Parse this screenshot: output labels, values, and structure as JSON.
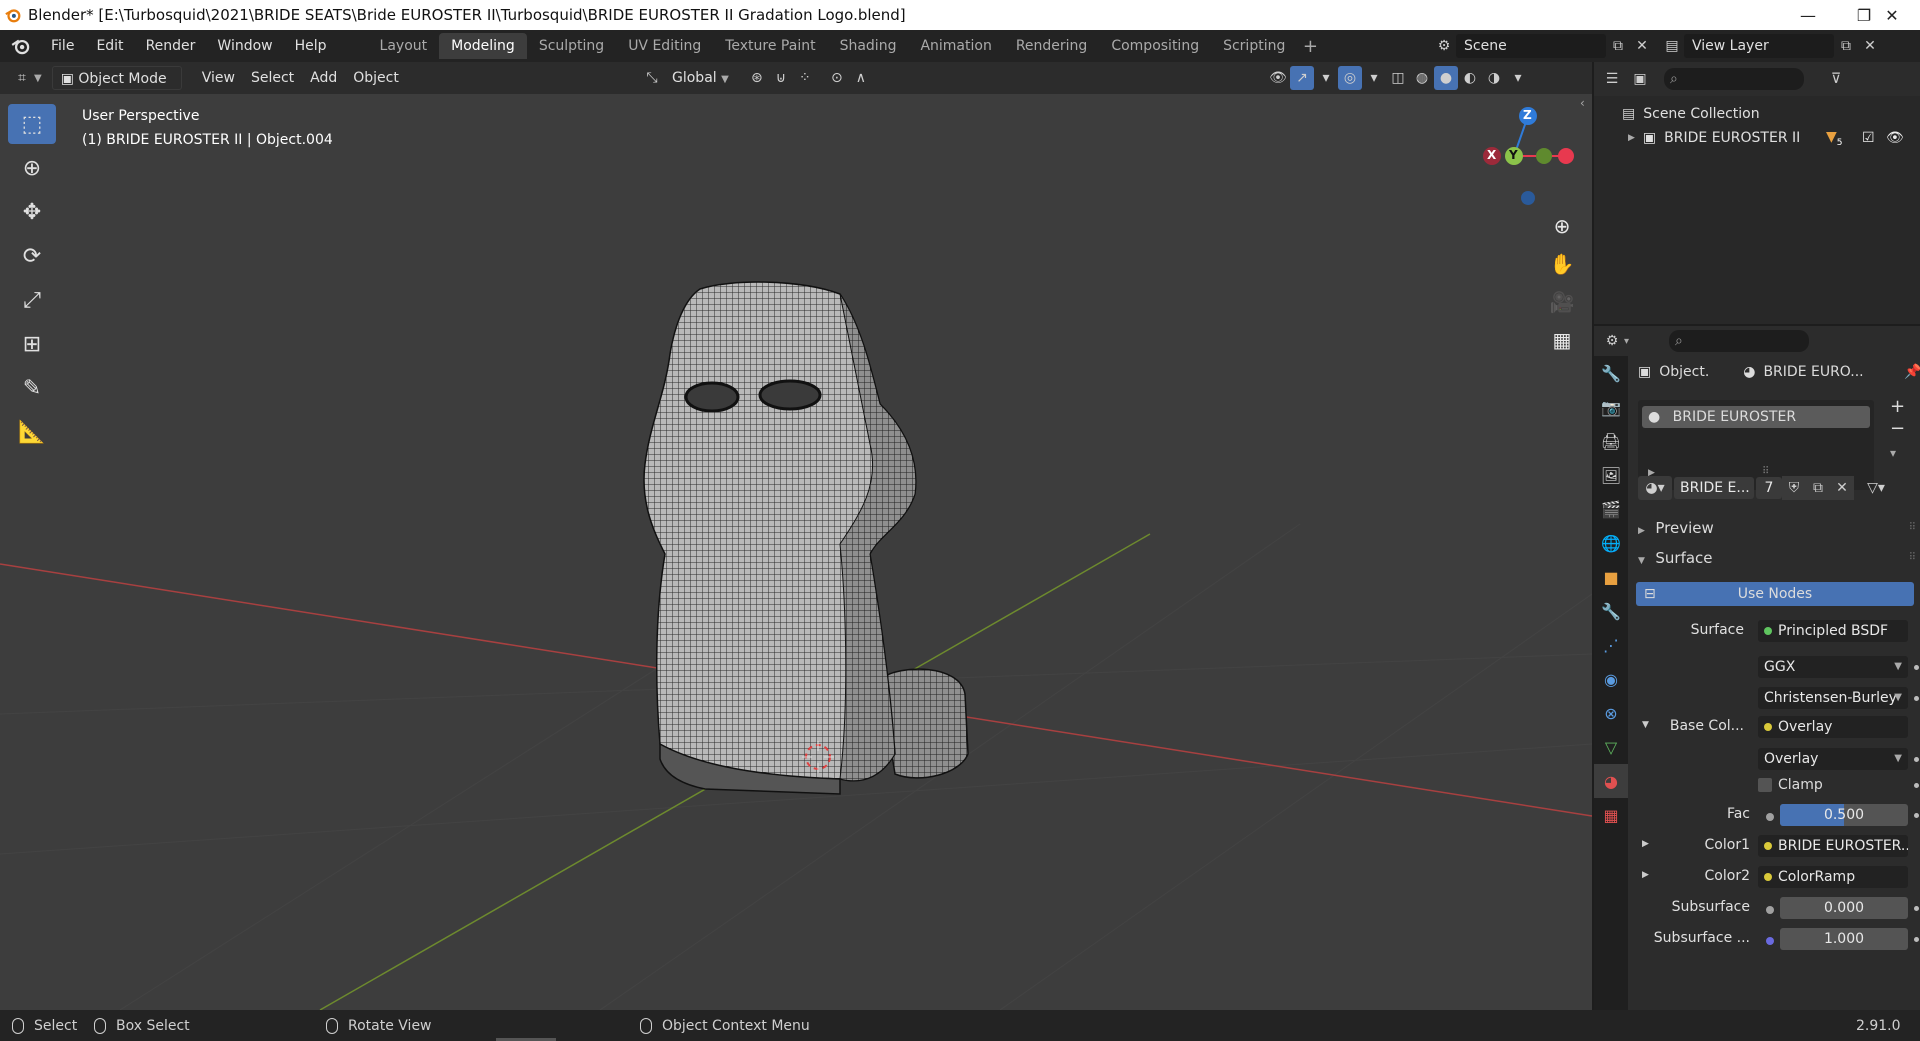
{
  "window": {
    "title": "Blender* [E:\\Turbosquid\\2021\\BRIDE SEATS\\Bride EUROSTER II\\Turbosquid\\BRIDE EUROSTER II Gradation Logo.blend]",
    "minimize_glyph": "—",
    "restore_glyph": "❐",
    "close_glyph": "✕"
  },
  "menu": [
    "File",
    "Edit",
    "Render",
    "Window",
    "Help"
  ],
  "workspaces": [
    "Layout",
    "Modeling",
    "Sculpting",
    "UV Editing",
    "Texture Paint",
    "Shading",
    "Animation",
    "Rendering",
    "Compositing",
    "Scripting"
  ],
  "active_workspace": "Modeling",
  "scene": {
    "name": "Scene"
  },
  "view_layer": {
    "name": "View Layer"
  },
  "viewport_header": {
    "mode": "Object Mode",
    "menus": [
      "View",
      "Select",
      "Add",
      "Object"
    ],
    "transform_orientation": "Global"
  },
  "viewport": {
    "perspective": "User Perspective",
    "object_info": "(1) BRIDE EUROSTER II | Object.004",
    "gizmo_axes": {
      "x": "X",
      "y": "Y",
      "z": "Z"
    }
  },
  "outliner": {
    "scene_collection": "Scene Collection",
    "items": [
      {
        "name": "BRIDE EUROSTER II",
        "badge": "5"
      }
    ]
  },
  "properties": {
    "context_object": "Object.",
    "context_material": "BRIDE EURO...",
    "material_slots": [
      "BRIDE EUROSTER"
    ],
    "material_name": "BRIDE E...",
    "user_count": "7",
    "panels": {
      "preview": "Preview",
      "surface": "Surface"
    },
    "use_nodes": "Use Nodes",
    "surface_label": "Surface",
    "surface_value": "Principled BSDF",
    "distribution": "GGX",
    "subsurface_method": "Christensen-Burley",
    "base_color_label": "Base Col...",
    "base_color_value": "Overlay",
    "blend_mode": "Overlay",
    "clamp_label": "Clamp",
    "fac_label": "Fac",
    "fac_value": "0.500",
    "fac": 0.5,
    "color1_label": "Color1",
    "color1_value": "BRIDE EUROSTER...",
    "color2_label": "Color2",
    "color2_value": "ColorRamp",
    "subsurface_label": "Subsurface",
    "subsurface_value": "0.000",
    "subsurface2_label": "Subsurface ...",
    "subsurface2_value": "1.000"
  },
  "statusbar": {
    "select": "Select",
    "box_select": "Box Select",
    "rotate_view": "Rotate View",
    "context_menu": "Object Context Menu",
    "version": "2.91.0"
  },
  "colors": {
    "accent": "#4772b3",
    "axis_x": "#e8394f",
    "axis_y": "#8bc34a",
    "axis_z": "#2f7bd9",
    "viewport_bg": "#3d3d3d"
  }
}
